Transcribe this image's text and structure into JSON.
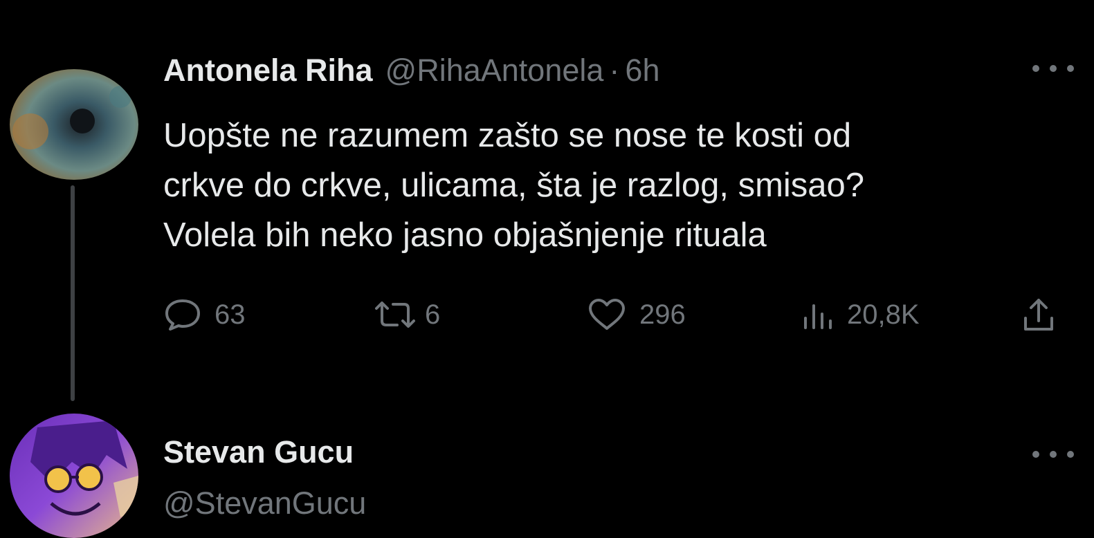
{
  "tweet": {
    "author_name": "Antonela Riha",
    "author_handle": "@RihaAntonela",
    "separator": "·",
    "time": "6h",
    "lines": [
      "Uopšte ne razumem zašto se nose te kosti od",
      "crkve do crkve, ulicama, šta je razlog, smisao?",
      "Volela bih neko jasno objašnjenje rituala"
    ],
    "actions": {
      "replies": "63",
      "retweets": "6",
      "likes": "296",
      "views": "20,8K"
    },
    "icons": {
      "reply": "speech-bubble-icon",
      "retweet": "retweet-arrows-icon",
      "like": "heart-icon",
      "views": "bar-chart-icon",
      "share": "share-upload-icon",
      "more": "ellipsis-icon"
    }
  },
  "reply": {
    "author_name": "Stevan Gucu",
    "author_handle": "@StevanGucu"
  },
  "colors": {
    "background": "#000000",
    "primary_text": "#e7e9ea",
    "secondary_text": "#71767b",
    "thread_line": "#3e4144"
  }
}
